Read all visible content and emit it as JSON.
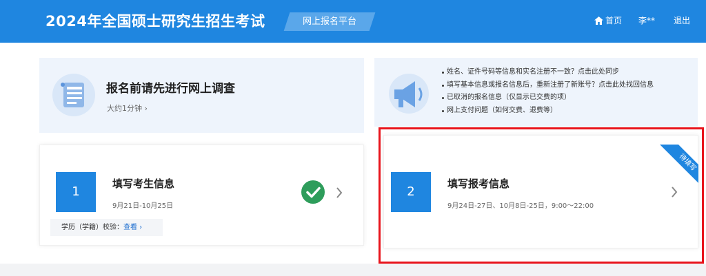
{
  "header": {
    "title": "2024年全国硕士研究生招生考试",
    "platform": "网上报名平台",
    "nav": {
      "home": "首页",
      "user": "李**",
      "logout": "退出"
    }
  },
  "survey": {
    "title": "报名前请先进行网上调查",
    "subtitle": "大约1分钟 ›"
  },
  "notices": [
    "姓名、证件号码等信息和实名注册不一致？点击此处同步",
    "填写基本信息或报名信息后，重新注册了新账号？点击此处找回信息",
    "已取消的报名信息（仅显示已交费的项）",
    "网上支付问题（如何交费、退费等）"
  ],
  "steps": [
    {
      "number": "1",
      "title": "填写考生信息",
      "date": "9月21日-10月25日",
      "status": "completed",
      "verify_label": "学历（学籍）校验：",
      "verify_link": "查看 ›"
    },
    {
      "number": "2",
      "title": "填写报考信息",
      "date": "9月24日-27日、10月8日-25日，9:00～22:00",
      "ribbon": "待填写"
    }
  ],
  "colors": {
    "brand": "#1f86e0",
    "highlight": "#e8131b",
    "success": "#2e9d5b"
  }
}
